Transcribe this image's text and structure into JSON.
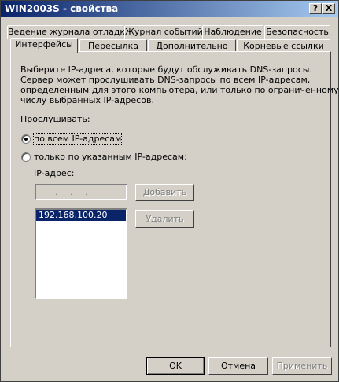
{
  "window": {
    "title": "WIN2003S - свойства"
  },
  "titlebar": {
    "help_label": "?",
    "close_label": "X"
  },
  "tabs": {
    "row1": [
      "Ведение журнала отладки",
      "Журнал событий",
      "Наблюдение",
      "Безопасность"
    ],
    "row2": [
      "Интерфейсы",
      "Пересылка",
      "Дополнительно",
      "Корневые ссылки"
    ],
    "active": "Интерфейсы"
  },
  "interfaces": {
    "description": [
      "Выберите IP-адреса, которые будут обслуживать DNS-запросы.",
      "Сервер может прослушивать DNS-запросы по всем IP-адресам,",
      "определенным для этого компьютера, или только по ограниченному",
      "числу выбранных IP-адресов."
    ],
    "listen_label": "Прослушивать:",
    "radio_all": "по всем IP-адресам",
    "radio_specific": "только по указанным IP-адресам:",
    "selected": "all",
    "ip_label": "IP-адрес:",
    "ip_input_value": " .  .  . ",
    "add_button": "Добавить",
    "remove_button": "Удалить",
    "ip_list": [
      "192.168.100.20"
    ]
  },
  "footer": {
    "ok": "OK",
    "cancel": "Отмена",
    "apply": "Применить"
  }
}
